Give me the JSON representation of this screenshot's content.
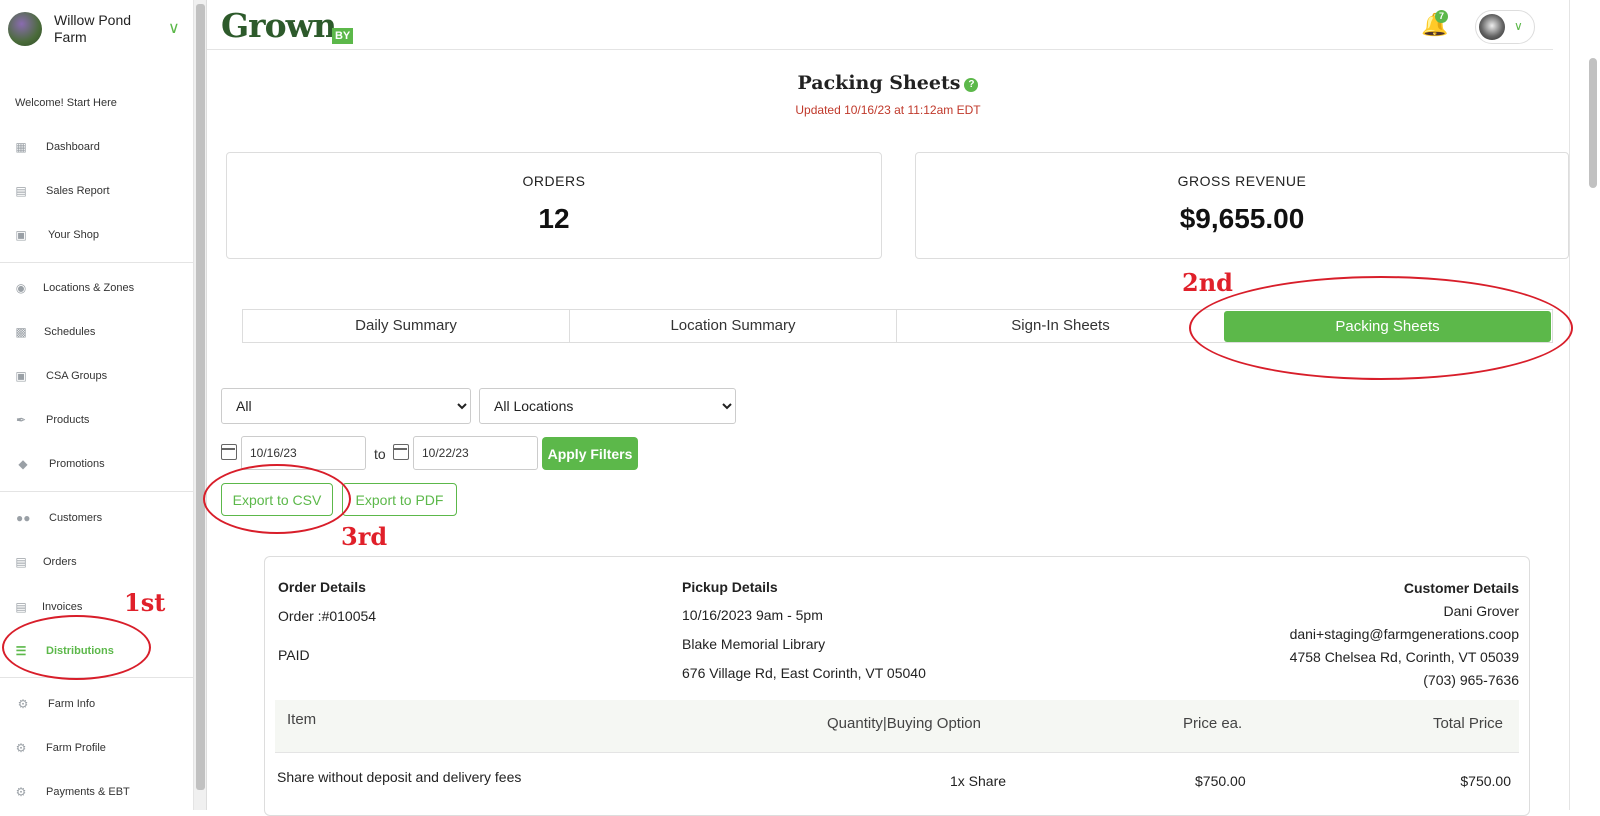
{
  "sidebar": {
    "farm_name": "Willow Pond Farm",
    "welcome": "Welcome! Start Here",
    "items": [
      {
        "label": "Dashboard",
        "icon": "dashboard-icon"
      },
      {
        "label": "Sales Report",
        "icon": "sales-report-icon"
      },
      {
        "label": "Your Shop",
        "icon": "shop-icon"
      },
      {
        "label": "Locations & Zones",
        "icon": "map-pin-icon"
      },
      {
        "label": "Schedules",
        "icon": "calendar-icon"
      },
      {
        "label": "CSA Groups",
        "icon": "box-icon"
      },
      {
        "label": "Products",
        "icon": "carrot-icon"
      },
      {
        "label": "Promotions",
        "icon": "tags-icon"
      },
      {
        "label": "Customers",
        "icon": "users-icon"
      },
      {
        "label": "Orders",
        "icon": "document-icon"
      },
      {
        "label": "Invoices",
        "icon": "invoice-icon"
      },
      {
        "label": "Distributions",
        "icon": "list-icon"
      },
      {
        "label": "Farm Info",
        "icon": "tractor-icon"
      },
      {
        "label": "Farm Profile",
        "icon": "gear-icon"
      },
      {
        "label": "Payments & EBT",
        "icon": "gear-icon"
      }
    ],
    "active_item": "Distributions"
  },
  "topbar": {
    "logo_text": "Grown",
    "logo_badge": "BY",
    "notification_count": "7"
  },
  "page": {
    "title": "Packing Sheets",
    "updated": "Updated 10/16/23 at 11:12am EDT",
    "help_icon": "?"
  },
  "stats": {
    "orders_label": "ORDERS",
    "orders_value": "12",
    "revenue_label": "GROSS REVENUE",
    "revenue_value": "$9,655.00"
  },
  "tabs": [
    {
      "label": "Daily Summary"
    },
    {
      "label": "Location Summary"
    },
    {
      "label": "Sign-In Sheets"
    },
    {
      "label": "Packing Sheets"
    }
  ],
  "filters": {
    "type_selected": "All",
    "location_selected": "All Locations",
    "date_from": "10/16/23",
    "to_label": "to",
    "date_to": "10/22/23",
    "apply_label": "Apply Filters",
    "export_csv": "Export to CSV",
    "export_pdf": "Export to PDF"
  },
  "annotations": {
    "first": "1st",
    "second": "2nd",
    "third": "3rd",
    "color": "#e0202a"
  },
  "order": {
    "order_details_h": "Order Details",
    "order_number": "Order :#010054",
    "status": "PAID",
    "pickup_h": "Pickup Details",
    "pickup_time": "10/16/2023 9am - 5pm",
    "pickup_location": "Blake Memorial Library",
    "pickup_address": "676 Village Rd, East Corinth, VT 05040",
    "customer_h": "Customer Details",
    "customer_name": "Dani Grover",
    "customer_email": "dani+staging@farmgenerations.coop",
    "customer_address": "4758 Chelsea Rd, Corinth, VT 05039",
    "customer_phone": "(703) 965-7636",
    "table_headers": {
      "item": "Item",
      "qty": "Quantity|Buying Option",
      "price": "Price ea.",
      "total": "Total Price"
    },
    "rows": [
      {
        "item": "Share without deposit and delivery fees",
        "qty": "1x Share",
        "price": "$750.00",
        "total": "$750.00"
      }
    ]
  },
  "colors": {
    "accent": "#5cb84a",
    "brand": "#2d5a2b",
    "alert": "#c0392b"
  }
}
